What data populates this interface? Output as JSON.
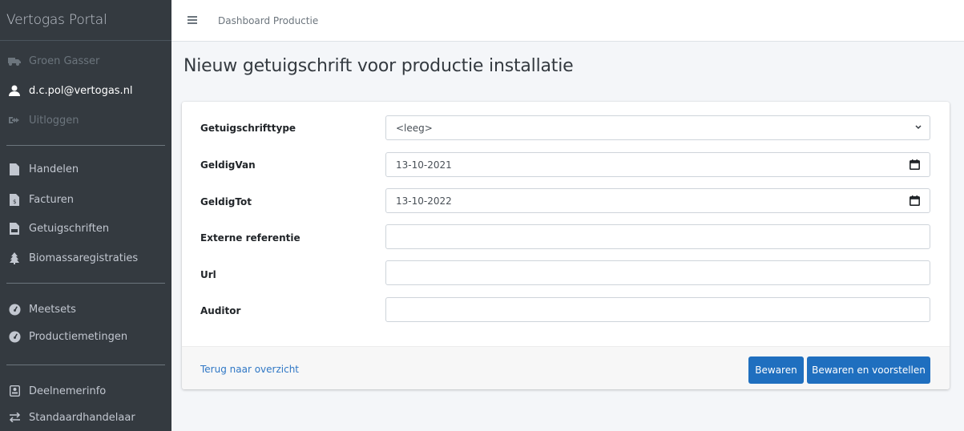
{
  "sidebar": {
    "brand": "Vertogas Portal",
    "account": [
      {
        "label": "Groen Gasser",
        "icon": "truck-icon",
        "disabled": true
      },
      {
        "label": "d.c.pol@vertogas.nl",
        "icon": "user-icon",
        "disabled": false
      },
      {
        "label": "Uitloggen",
        "icon": "sign-out-icon",
        "disabled": true
      }
    ],
    "group1": [
      {
        "label": "Handelen",
        "icon": "file-icon"
      },
      {
        "label": "Facturen",
        "icon": "invoice-icon"
      },
      {
        "label": "Getuigschriften",
        "icon": "certificate-icon"
      },
      {
        "label": "Biomassaregistraties",
        "icon": "tree-icon"
      }
    ],
    "group2": [
      {
        "label": "Meetsets",
        "icon": "gauge-icon"
      },
      {
        "label": "Productiemetingen",
        "icon": "gauge-icon"
      }
    ],
    "group3": [
      {
        "label": "Deelnemerinfo",
        "icon": "id-card-icon"
      },
      {
        "label": "Standaardhandelaar",
        "icon": "exchange-icon"
      }
    ]
  },
  "topbar": {
    "breadcrumb": "Dashboard Productie"
  },
  "page": {
    "title": "Nieuw getuigschrift voor productie installatie"
  },
  "form": {
    "fields": [
      {
        "label": "Getuigschrifttype",
        "value": "<leeg>",
        "type": "select"
      },
      {
        "label": "GeldigVan",
        "value": "13-10-2021",
        "type": "date"
      },
      {
        "label": "GeldigTot",
        "value": "13-10-2022",
        "type": "date"
      },
      {
        "label": "Externe referentie",
        "value": "",
        "type": "text"
      },
      {
        "label": "Url",
        "value": "",
        "type": "text"
      },
      {
        "label": "Auditor",
        "value": "",
        "type": "text"
      }
    ]
  },
  "footer": {
    "back_link": "Terug naar overzicht",
    "save_label": "Bewaren",
    "save_propose_label": "Bewaren en voorstellen"
  },
  "colors": {
    "sidebar_bg": "#343a40",
    "primary": "#1f6fbf",
    "link": "#2f77c5",
    "page_bg": "#f4f6f9"
  }
}
